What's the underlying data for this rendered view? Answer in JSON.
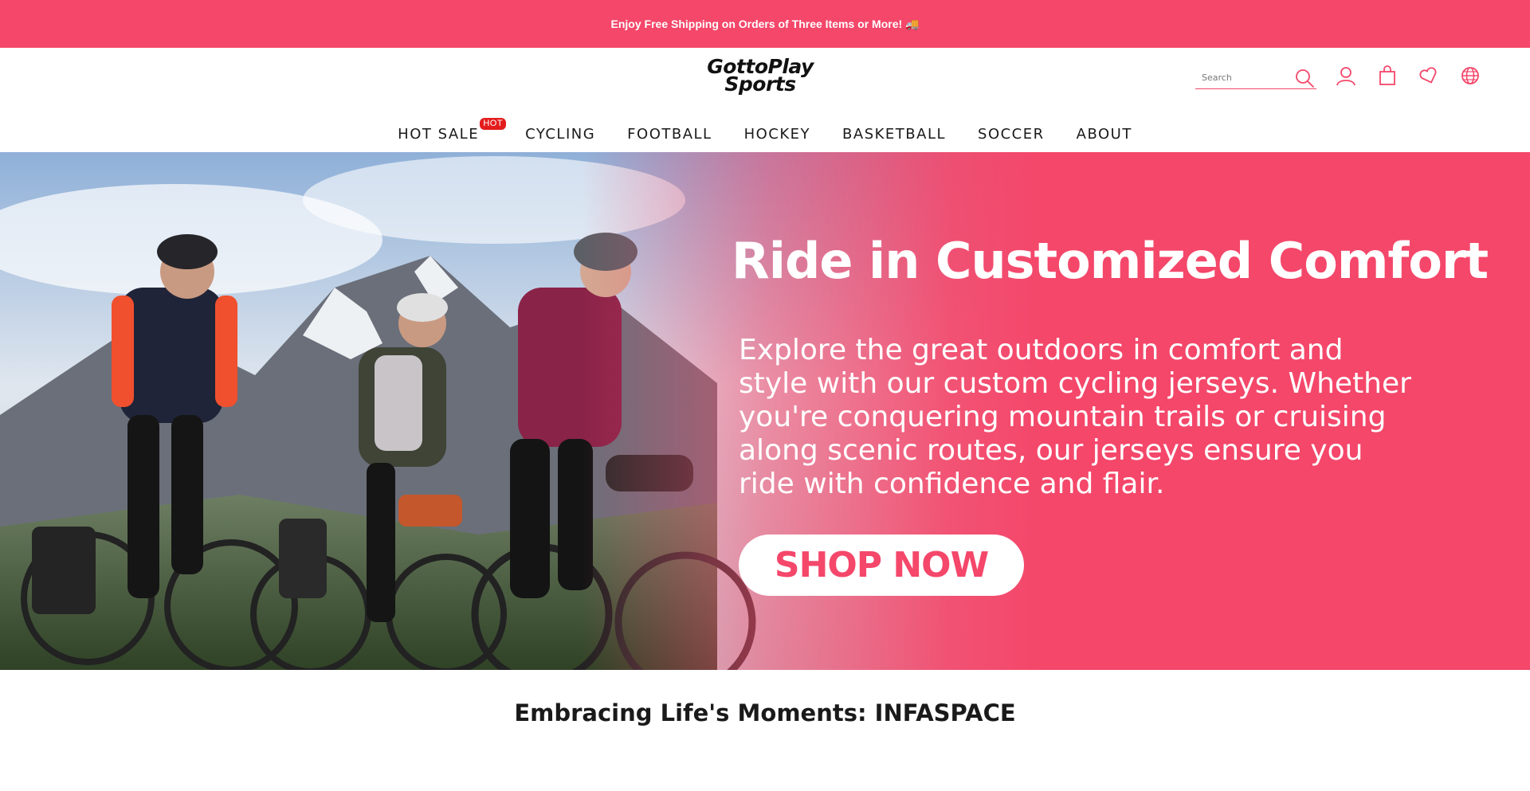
{
  "announcement": {
    "text": "Enjoy Free Shipping on Orders of Three Items or More! 🚚"
  },
  "header": {
    "logo_line1": "GottoPlay",
    "logo_line2": "Sports",
    "search_placeholder": "Search",
    "icons": [
      "search-icon",
      "account-icon",
      "cart-icon",
      "wishlist-icon",
      "language-icon"
    ],
    "accent_color": "#f4476a"
  },
  "nav": {
    "items": [
      {
        "label": "HOT SALE",
        "badge": "HOT"
      },
      {
        "label": "CYCLING"
      },
      {
        "label": "FOOTBALL"
      },
      {
        "label": "HOCKEY"
      },
      {
        "label": "BASKETBALL"
      },
      {
        "label": "SOCCER"
      },
      {
        "label": "ABOUT"
      }
    ]
  },
  "hero": {
    "title": "Ride in Customized Comfort",
    "text": "Explore the great outdoors in comfort and style with our custom cycling jerseys. Whether you're conquering mountain trails or cruising along scenic routes, our jerseys ensure you ride with confidence and flair.",
    "cta_label": "SHOP NOW",
    "background_color": "#f4476a"
  },
  "section": {
    "title": "Embracing Life's Moments: INFASPACE"
  }
}
